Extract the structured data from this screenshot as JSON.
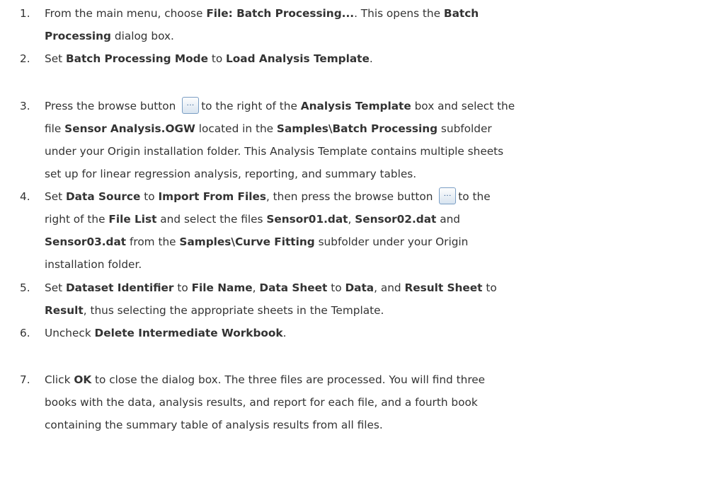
{
  "steps": [
    {
      "number": "1.",
      "lines": [
        [
          {
            "t": "From the main menu, choose "
          },
          {
            "t": "File: Batch Processing...",
            "b": true
          },
          {
            "t": ". This opens the "
          },
          {
            "t": "Batch",
            "b": true
          }
        ],
        [
          {
            "t": "Processing",
            "b": true
          },
          {
            "t": " dialog box."
          }
        ]
      ]
    },
    {
      "number": "2.",
      "lines": [
        [
          {
            "t": "Set "
          },
          {
            "t": "Batch Processing Mode",
            "b": true
          },
          {
            "t": " to "
          },
          {
            "t": "Load Analysis Template",
            "b": true
          },
          {
            "t": "."
          }
        ]
      ]
    },
    {
      "number": "3.",
      "lines": [
        [
          {
            "t": "Press the browse button "
          },
          {
            "icon": "browse-button",
            "label": "..."
          },
          {
            "t": "to the right of the "
          },
          {
            "t": "Analysis Template",
            "b": true
          },
          {
            "t": " box and select the"
          }
        ],
        [
          {
            "t": "file "
          },
          {
            "t": "Sensor Analysis.OGW",
            "b": true
          },
          {
            "t": " located in the "
          },
          {
            "t": "Samples\\Batch Processing",
            "b": true
          },
          {
            "t": " subfolder"
          }
        ],
        [
          {
            "t": "under your Origin installation folder. This Analysis Template contains multiple sheets"
          }
        ],
        [
          {
            "t": "set up for linear regression analysis, reporting, and summary tables."
          }
        ]
      ]
    },
    {
      "number": "4.",
      "lines": [
        [
          {
            "t": "Set "
          },
          {
            "t": "Data Source",
            "b": true
          },
          {
            "t": " to "
          },
          {
            "t": "Import From Files",
            "b": true
          },
          {
            "t": ", then press the browse button "
          },
          {
            "icon": "browse-button",
            "label": "..."
          },
          {
            "t": "to the"
          }
        ],
        [
          {
            "t": "right of the "
          },
          {
            "t": "File List",
            "b": true
          },
          {
            "t": " and select the files "
          },
          {
            "t": "Sensor01.dat",
            "b": true
          },
          {
            "t": ", "
          },
          {
            "t": "Sensor02.dat",
            "b": true
          },
          {
            "t": " and"
          }
        ],
        [
          {
            "t": "Sensor03.dat",
            "b": true
          },
          {
            "t": " from the "
          },
          {
            "t": "Samples\\Curve Fitting",
            "b": true
          },
          {
            "t": " subfolder under your Origin"
          }
        ],
        [
          {
            "t": "installation folder."
          }
        ]
      ]
    },
    {
      "number": "5.",
      "lines": [
        [
          {
            "t": "Set "
          },
          {
            "t": "Dataset Identifier",
            "b": true
          },
          {
            "t": " to "
          },
          {
            "t": "File Name",
            "b": true
          },
          {
            "t": ", "
          },
          {
            "t": "Data Sheet",
            "b": true
          },
          {
            "t": " to "
          },
          {
            "t": "Data",
            "b": true
          },
          {
            "t": ", and "
          },
          {
            "t": "Result Sheet",
            "b": true
          },
          {
            "t": " to"
          }
        ],
        [
          {
            "t": "Result",
            "b": true
          },
          {
            "t": ", thus selecting the appropriate sheets in the Template."
          }
        ]
      ]
    },
    {
      "number": "6.",
      "lines": [
        [
          {
            "t": "Uncheck "
          },
          {
            "t": "Delete Intermediate Workbook",
            "b": true
          },
          {
            "t": "."
          }
        ]
      ]
    },
    {
      "number": "7.",
      "lines": [
        [
          {
            "t": "Click "
          },
          {
            "t": "OK",
            "b": true
          },
          {
            "t": " to close the dialog box. The three files are processed. You will find three"
          }
        ],
        [
          {
            "t": "books with the data, analysis results, and report for each file, and a fourth book"
          }
        ],
        [
          {
            "t": "containing the summary table of analysis results from all files."
          }
        ]
      ]
    }
  ]
}
